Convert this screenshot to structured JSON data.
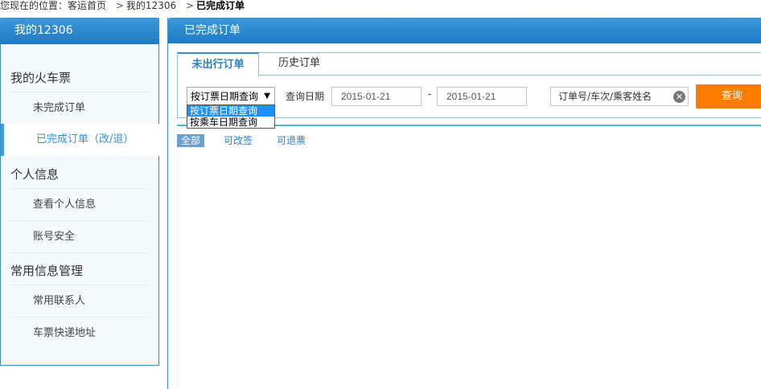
{
  "breadcrumb": {
    "prefix": "您现在的位置：",
    "home": "客运首页",
    "section": "我的12306",
    "current": "已完成订单",
    "sep": ">"
  },
  "sidebar": {
    "title": "我的12306",
    "groups": [
      {
        "title": "我的火车票",
        "items": [
          "未完成订单",
          "已完成订单（改/退）"
        ]
      },
      {
        "title": "个人信息",
        "items": [
          "查看个人信息",
          "账号安全"
        ]
      },
      {
        "title": "常用信息管理",
        "items": [
          "常用联系人",
          "车票快递地址"
        ]
      }
    ],
    "active_item": "已完成订单（改/退）"
  },
  "main": {
    "title": "已完成订单",
    "tabs": [
      {
        "label": "未出行订单",
        "active": true
      },
      {
        "label": "历史订单",
        "active": false
      }
    ],
    "query": {
      "type_select": {
        "selected": "按订票日期查询",
        "options": [
          "按订票日期查询",
          "按乘车日期查询"
        ]
      },
      "date_label": "查询日期",
      "date_from": "2015-01-21",
      "date_to": "2015-01-21",
      "date_dash": "-",
      "keyword_placeholder": "订单号/车次/乘客姓名",
      "button": "查询"
    },
    "filters": [
      "全部",
      "可改签",
      "可退票"
    ]
  },
  "colors": {
    "accent_blue": "#2e91d9",
    "header_blue": "#1e7ac3",
    "query_orange": "#ff7c00"
  }
}
